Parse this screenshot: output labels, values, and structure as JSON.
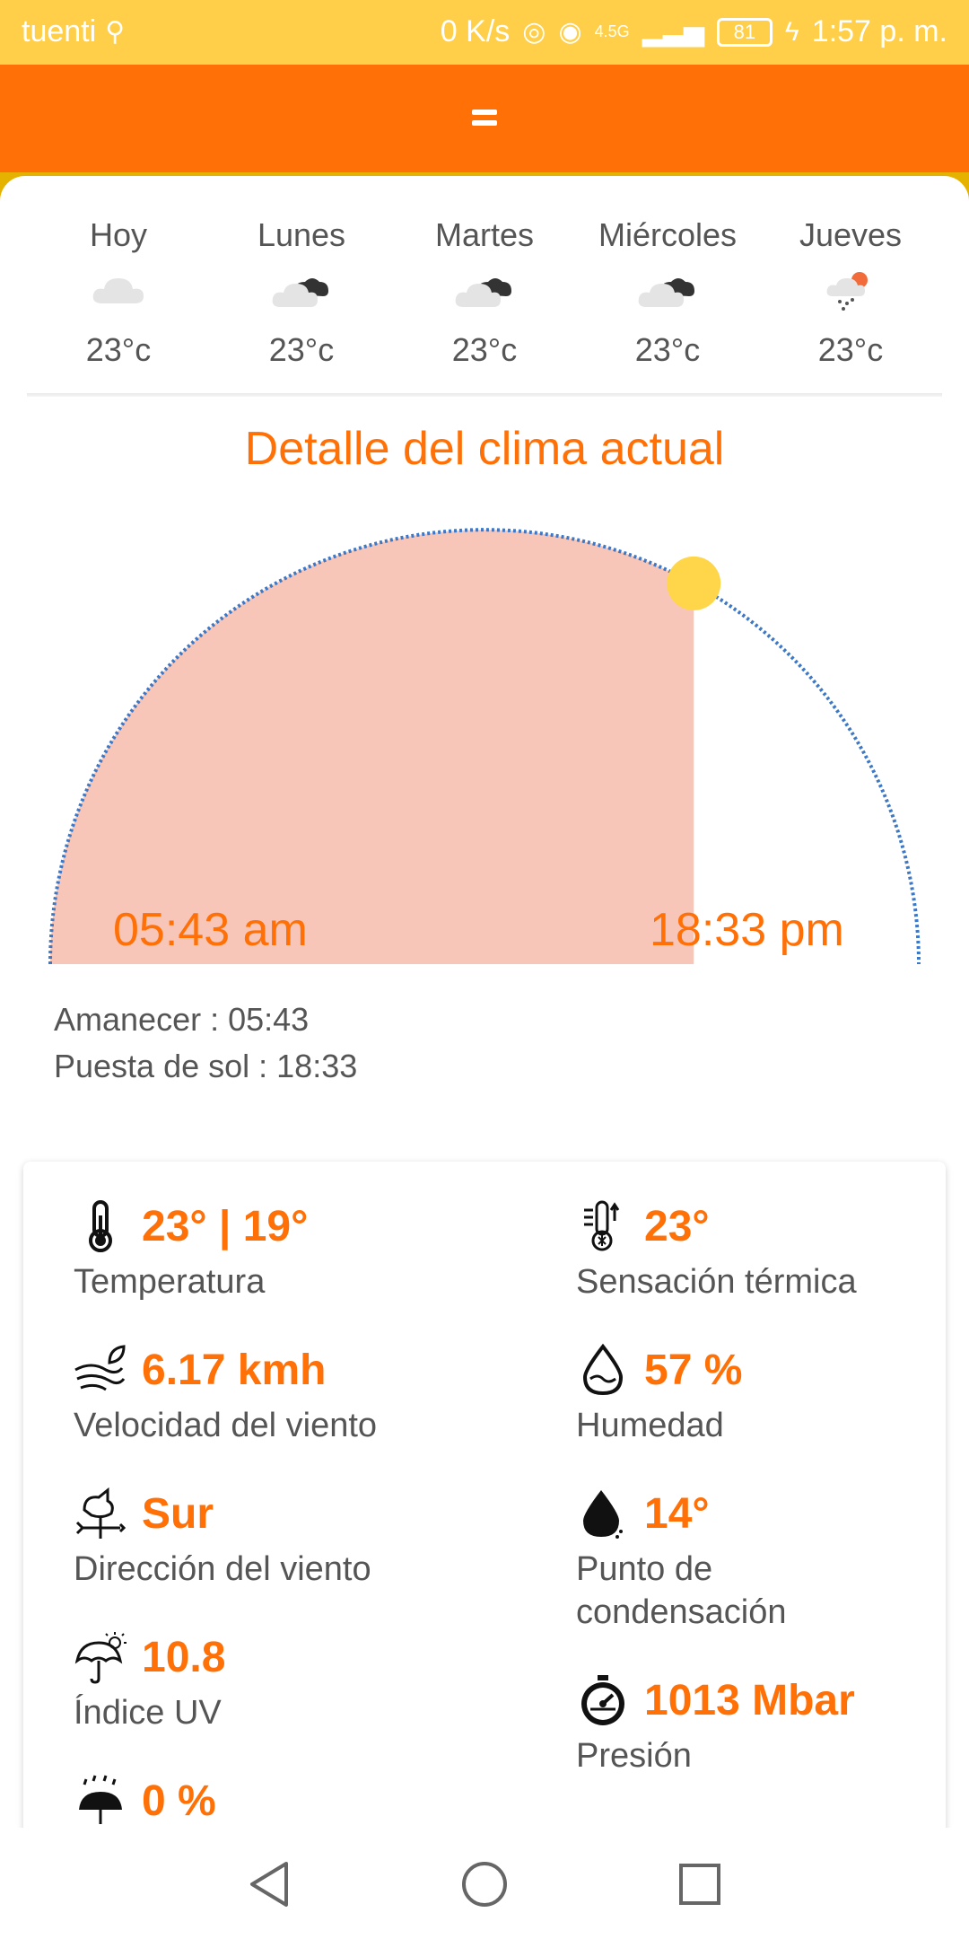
{
  "status_bar": {
    "carrier": "tuenti",
    "speed": "0 K/s",
    "signal_label": "4.5G",
    "battery": "81",
    "time": "1:57 p. m."
  },
  "forecast": [
    {
      "day": "Hoy",
      "temp": "23°c",
      "icon": "cloud-icon"
    },
    {
      "day": "Lunes",
      "temp": "23°c",
      "icon": "dark-clouds-icon"
    },
    {
      "day": "Martes",
      "temp": "23°c",
      "icon": "dark-clouds-icon"
    },
    {
      "day": "Miércoles",
      "temp": "23°c",
      "icon": "dark-clouds-icon"
    },
    {
      "day": "Jueves",
      "temp": "23°c",
      "icon": "snow-sun-icon"
    }
  ],
  "detail": {
    "title": "Detalle del clima actual",
    "sunrise_time": "05:43 am",
    "sunset_time": "18:33 pm",
    "sunrise_text": "Amanecer : 05:43",
    "sunset_text": "Puesta de sol : 18:33",
    "day_progress": 0.66
  },
  "metrics": {
    "temperatura": {
      "value": "23° | 19°",
      "label": "Temperatura"
    },
    "sensacion": {
      "value": "23°",
      "label": "Sensación térmica"
    },
    "viento_vel": {
      "value": "6.17 kmh",
      "label": "Velocidad del viento"
    },
    "humedad": {
      "value": "57 %",
      "label": "Humedad"
    },
    "viento_dir": {
      "value": "Sur",
      "label": "Dirección del viento"
    },
    "condensacion": {
      "value": "14°",
      "label": "Punto de condensación"
    },
    "uv": {
      "value": "10.8",
      "label": "Índice UV"
    },
    "presion": {
      "value": "1013 Mbar",
      "label": "Presión"
    },
    "lluvia": {
      "value": "0 %"
    }
  },
  "colors": {
    "status_bar": "#FFCF4A",
    "toolbar": "#FF7007",
    "accent": "#FF7007",
    "sun": "#FFD54A",
    "day_fill": "#F8C6B8",
    "arc": "#3D78C7"
  }
}
